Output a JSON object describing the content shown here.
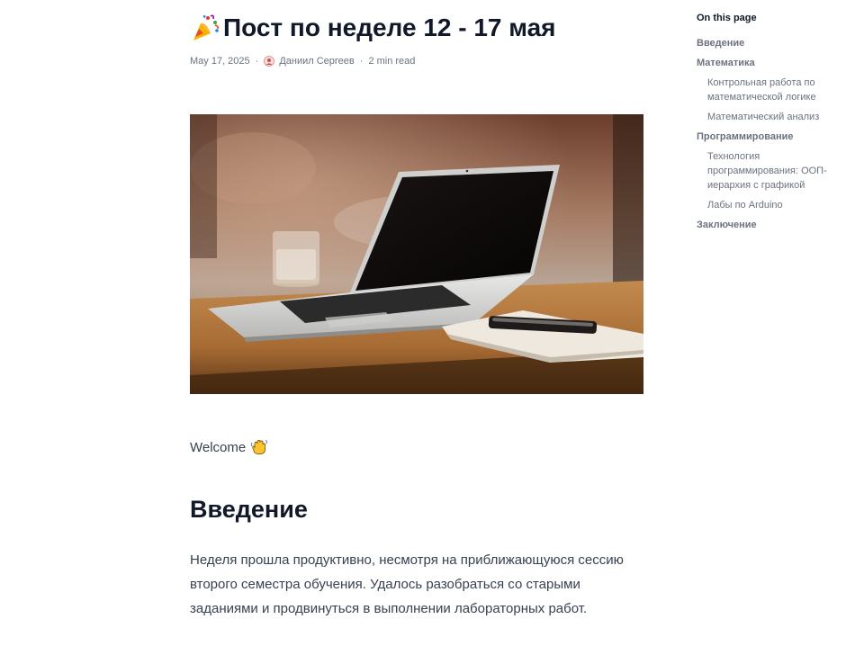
{
  "post": {
    "title": "Пост по неделе 12 - 17 мая",
    "title_emoji": "party-popper-icon",
    "date": "May 17, 2025",
    "separator": "·",
    "author": "Даниил Сергеев",
    "read_time": "2 min read",
    "hero_image": "laptop-on-wooden-table",
    "welcome_text": "Welcome",
    "welcome_emoji": "waving-hand-icon",
    "section_heading": "Введение",
    "section_text": "Неделя прошла продуктивно, несмотря на приближающуюся сессию второго семестра обучения. Удалось разобраться со старыми заданиями и продвинуться в выполнении лабораторных работ."
  },
  "toc": {
    "heading": "On this page",
    "items": [
      {
        "label": "Введение",
        "level": 1
      },
      {
        "label": "Математика",
        "level": 1
      },
      {
        "label": "Контрольная работа по математической логике",
        "level": 2
      },
      {
        "label": "Математический анализ",
        "level": 2
      },
      {
        "label": "Программирование",
        "level": 1
      },
      {
        "label": "Технология программирования: ООП-иерархия с графикой",
        "level": 2
      },
      {
        "label": "Лабы по Arduino",
        "level": 2
      },
      {
        "label": "Заключение",
        "level": 1
      }
    ]
  },
  "colors": {
    "text_primary": "#111827",
    "text_body": "#374151",
    "text_muted": "#6b7280"
  }
}
